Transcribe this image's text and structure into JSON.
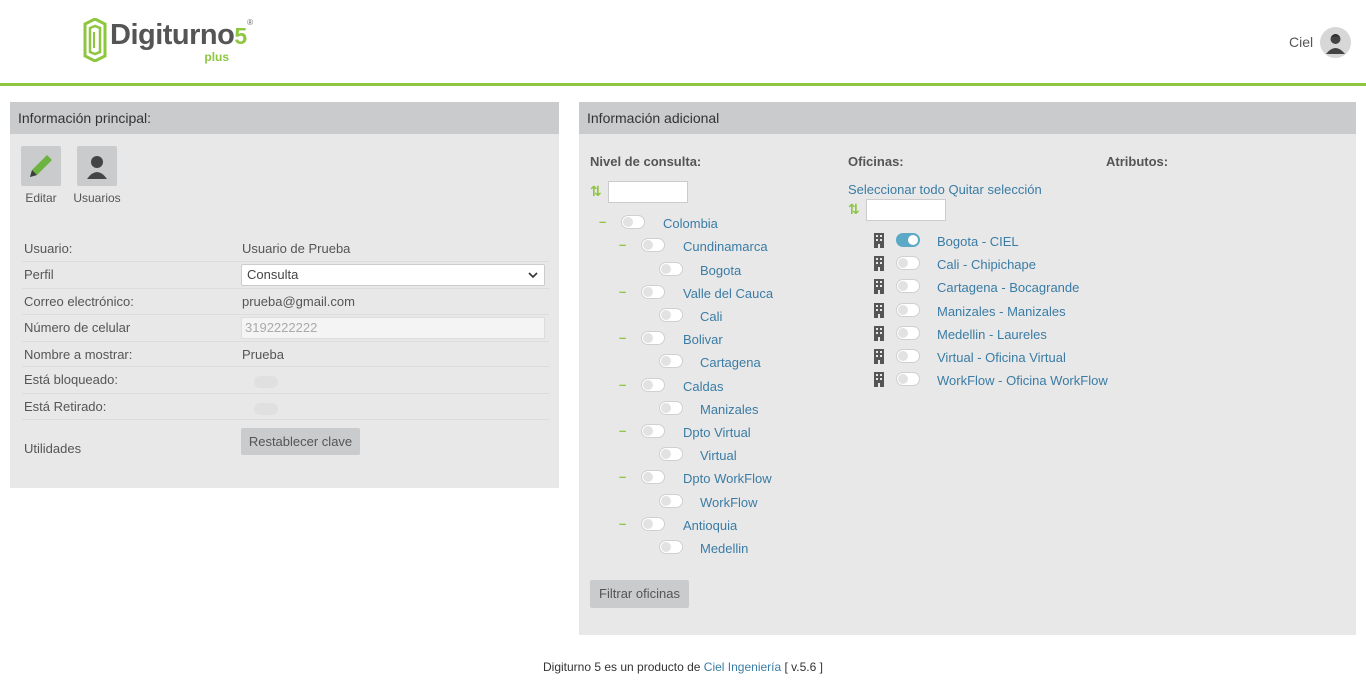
{
  "header": {
    "logo_name": "Digiturno",
    "logo_number": "5",
    "logo_reg": "®",
    "logo_sub": "plus",
    "user_name": "Ciel",
    "accent_color": "#8dc63f"
  },
  "left_panel": {
    "title": "Información principal:",
    "tools": [
      {
        "label": "Editar",
        "icon": "pencil-icon"
      },
      {
        "label": "Usuarios",
        "icon": "user-icon"
      }
    ],
    "fields": {
      "usuario": {
        "label": "Usuario:",
        "value": "Usuario de Prueba"
      },
      "perfil": {
        "label": "Perfil",
        "value": "Consulta"
      },
      "correo": {
        "label": "Correo electrónico:",
        "value": "prueba@gmail.com"
      },
      "celular": {
        "label": "Número de celular",
        "value": "3192222222"
      },
      "nombre": {
        "label": "Nombre a mostrar:",
        "value": "Prueba"
      },
      "bloqueado": {
        "label": "Está bloqueado:",
        "value": false
      },
      "retirado": {
        "label": "Está Retirado:",
        "value": false
      },
      "utilidades": {
        "label": "Utilidades",
        "button": "Restablecer clave"
      }
    }
  },
  "right_panel": {
    "title": "Información adicional",
    "nivel": {
      "title": "Nivel de consulta:",
      "tree": [
        {
          "label": "Colombia"
        },
        {
          "label": "Cundinamarca"
        },
        {
          "label": "Bogota"
        },
        {
          "label": "Valle del Cauca"
        },
        {
          "label": "Cali"
        },
        {
          "label": "Bolivar"
        },
        {
          "label": "Cartagena"
        },
        {
          "label": "Caldas"
        },
        {
          "label": "Manizales"
        },
        {
          "label": "Dpto Virtual"
        },
        {
          "label": "Virtual"
        },
        {
          "label": "Dpto WorkFlow"
        },
        {
          "label": "WorkFlow"
        },
        {
          "label": "Antioquia"
        },
        {
          "label": "Medellin"
        }
      ],
      "filter_button": "Filtrar oficinas"
    },
    "oficinas": {
      "title": "Oficinas:",
      "select_all": "Seleccionar todo",
      "clear_selection": "Quitar selección",
      "items": [
        {
          "label": "Bogota - CIEL",
          "selected": true
        },
        {
          "label": "Cali - Chipichape",
          "selected": false
        },
        {
          "label": "Cartagena - Bocagrande",
          "selected": false
        },
        {
          "label": "Manizales - Manizales",
          "selected": false
        },
        {
          "label": "Medellin - Laureles",
          "selected": false
        },
        {
          "label": "Virtual - Oficina Virtual",
          "selected": false
        },
        {
          "label": "WorkFlow - Oficina WorkFlow",
          "selected": false
        }
      ]
    },
    "atributos": {
      "title": "Atributos:"
    }
  },
  "footer": {
    "text": "Digiturno 5 es un producto de",
    "link": "Ciel Ingeniería",
    "version": "[ v.5.6 ]"
  }
}
